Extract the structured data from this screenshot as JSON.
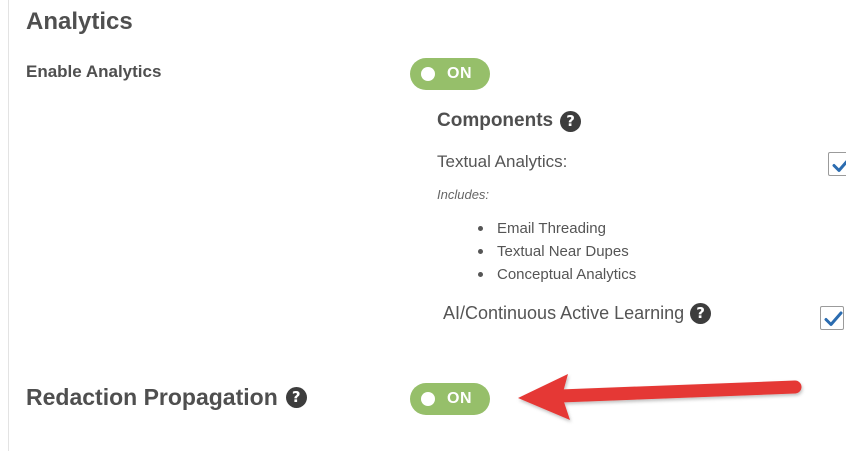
{
  "analytics": {
    "title": "Analytics",
    "enable_label": "Enable Analytics",
    "toggle_label": "ON",
    "toggle_on": true,
    "components": {
      "heading": "Components",
      "textual": {
        "label": "Textual Analytics:",
        "checked": true,
        "includes_label": "Includes:",
        "includes": [
          "Email Threading",
          "Textual Near Dupes",
          "Conceptual Analytics"
        ]
      },
      "ai": {
        "label": "AI/Continuous Active Learning",
        "checked": true
      }
    }
  },
  "redaction": {
    "label": "Redaction Propagation",
    "toggle_label": "ON",
    "toggle_on": true
  },
  "icons": {
    "help": "question-circle-icon",
    "check": "checkmark-icon",
    "annotation": "red-arrow-annotation"
  },
  "colors": {
    "toggle_on": "#96bf6a",
    "check": "#2b6cb0",
    "arrow": "#e53935",
    "label_text": "#4f4f4f"
  }
}
